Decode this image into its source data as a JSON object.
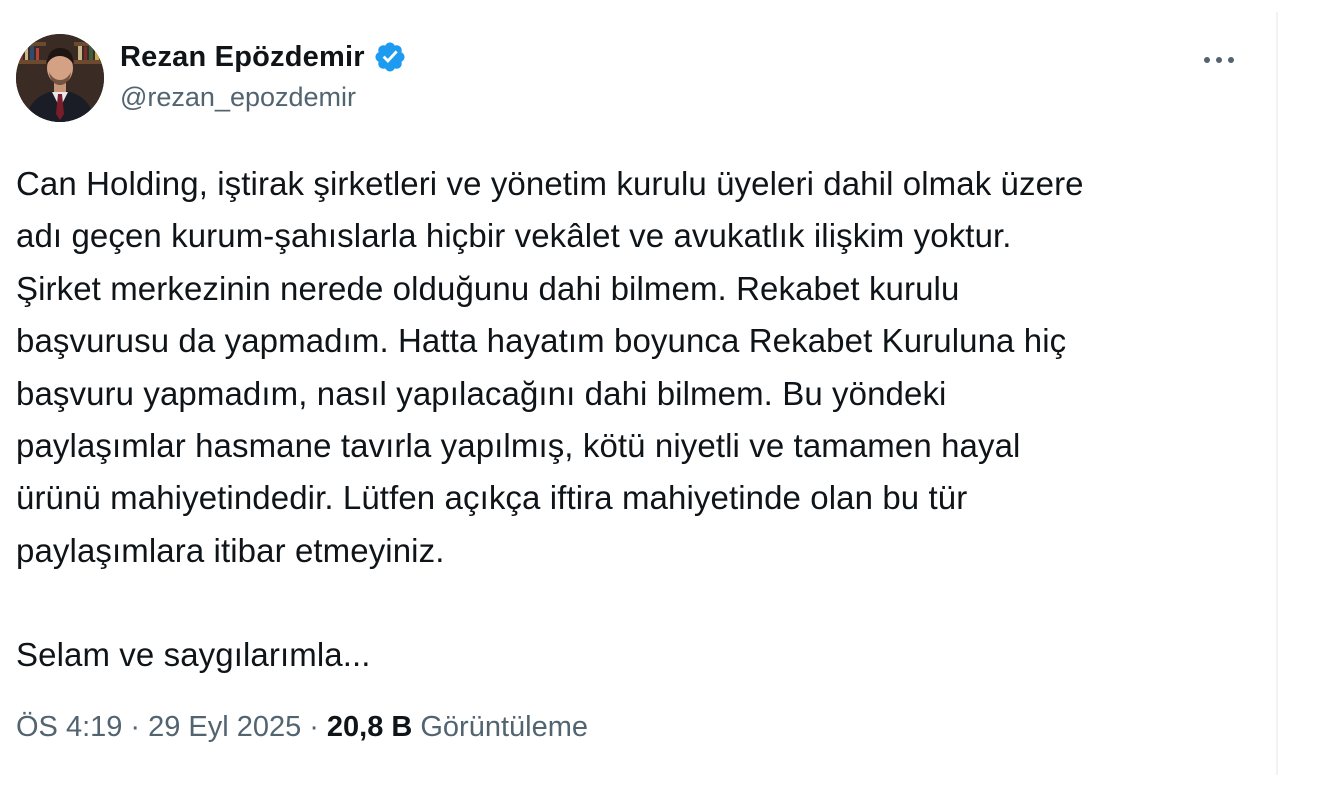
{
  "author": {
    "display_name": "Rezan Epözdemir",
    "handle": "@rezan_epozdemir",
    "verified": true,
    "avatar_icon": "profile-photo",
    "verified_icon": "verified-badge-icon",
    "verified_color": "#1d9bf0"
  },
  "more_icon": "more-horizontal-icon",
  "body": {
    "lines": [
      "Can Holding, iştirak şirketleri ve yönetim kurulu üyeleri dahil olmak üzere",
      "adı geçen kurum-şahıslarla hiçbir vekâlet ve avukatlık ilişkim yoktur.",
      "Şirket merkezinin nerede olduğunu dahi bilmem. Rekabet kurulu",
      "başvurusu da yapmadım. Hatta hayatım boyunca Rekabet Kuruluna hiç",
      "başvuru yapmadım, nasıl yapılacağını dahi bilmem. Bu yöndeki",
      "paylaşımlar hasmane tavırla yapılmış, kötü niyetli ve tamamen hayal",
      "ürünü mahiyetindedir. Lütfen açıkça iftira mahiyetinde olan bu tür",
      "paylaşımlara itibar etmeyiniz."
    ],
    "closing": "Selam ve saygılarımla..."
  },
  "meta": {
    "time": "ÖS 4:19",
    "date": "29 Eyl 2025",
    "separator": "·",
    "views_count": "20,8 B",
    "views_label": "Görüntüleme"
  },
  "colors": {
    "text_primary": "#0f1419",
    "text_secondary": "#536471",
    "divider": "#eff3f4"
  }
}
